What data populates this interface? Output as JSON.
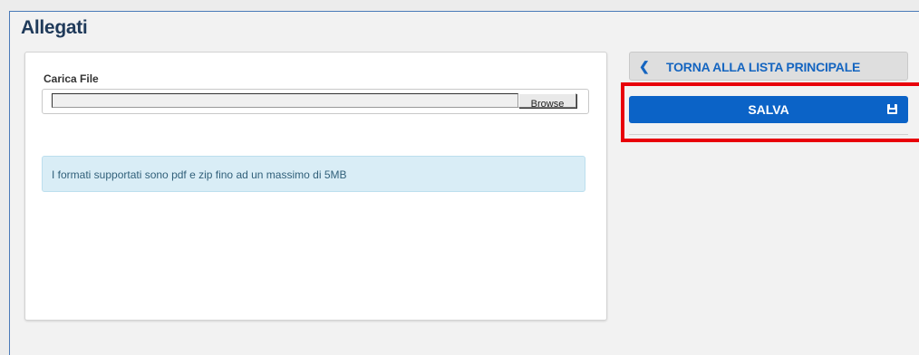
{
  "panel": {
    "title": "Allegati"
  },
  "upload": {
    "label": "Carica File",
    "browse_label": "Browse",
    "info": "I formati supportati sono pdf e zip fino ad un massimo di 5MB"
  },
  "actions": {
    "back_label": "TORNA ALLA LISTA PRINCIPALE",
    "save_label": "SALVA"
  },
  "icons": {
    "back": "chevron-left-icon",
    "save": "floppy-disk-icon"
  },
  "colors": {
    "primary": "#0b63c7",
    "link": "#1565c0",
    "info_bg": "#d9edf6",
    "highlight": "#e8000a"
  }
}
